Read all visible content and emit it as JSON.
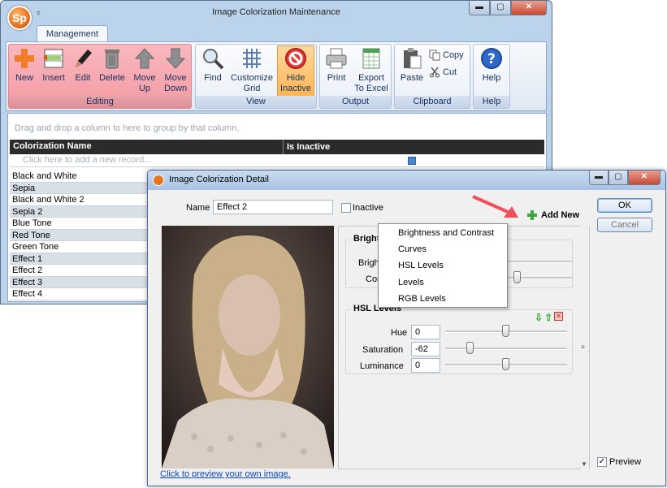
{
  "main": {
    "title": "Image Colorization Maintenance",
    "tab": "Management",
    "groups": {
      "editing": "Editing",
      "view": "View",
      "output": "Output",
      "clipboard": "Clipboard",
      "help": "Help"
    },
    "buttons": {
      "new": "New",
      "insert": "Insert",
      "edit": "Edit",
      "delete": "Delete",
      "move_up_1": "Move",
      "move_up_2": "Up",
      "move_down_1": "Move",
      "move_down_2": "Down",
      "find": "Find",
      "customize_1": "Customize",
      "customize_2": "Grid",
      "hide_1": "Hide",
      "hide_2": "Inactive",
      "print": "Print",
      "export_1": "Export",
      "export_2": "To Excel",
      "paste": "Paste",
      "copy": "Copy",
      "cut": "Cut",
      "help": "Help"
    },
    "grid": {
      "group_hint": "Drag and drop a column to here to group by that column.",
      "col_name": "Colorization Name",
      "col_inactive": "Is Inactive",
      "new_row": "Click here to add a new record...",
      "rows": [
        "Black and White",
        "Sepia",
        "Black and White 2",
        "Sepia 2",
        "Blue Tone",
        "Red Tone",
        "Green Tone",
        "Effect 1",
        "Effect 2",
        "Effect 3",
        "Effect 4"
      ]
    }
  },
  "detail": {
    "title": "Image Colorization Detail",
    "name_label": "Name",
    "name_value": "Effect 2",
    "inactive_label": "Inactive",
    "ok": "OK",
    "cancel": "Cancel",
    "add_new": "Add New",
    "preview_label": "Preview",
    "link": "Click to preview your own image.",
    "bc": {
      "title": "Brightness & Contrast",
      "brightness_label": "Brightness",
      "brightness_value": "0",
      "contrast_label": "Contrast",
      "contrast_value": "25"
    },
    "hsl": {
      "title": "HSL Levels",
      "hue_label": "Hue",
      "hue_value": "0",
      "sat_label": "Saturation",
      "sat_value": "-62",
      "lum_label": "Luminance",
      "lum_value": "0"
    },
    "menu": [
      "Brightness and Contrast",
      "Curves",
      "HSL Levels",
      "Levels",
      "RGB Levels"
    ]
  },
  "colors": {
    "editing_group": "#f49aa3",
    "accent": "#ffb552",
    "link": "#0a46c8",
    "arrow": "#f0505a"
  }
}
